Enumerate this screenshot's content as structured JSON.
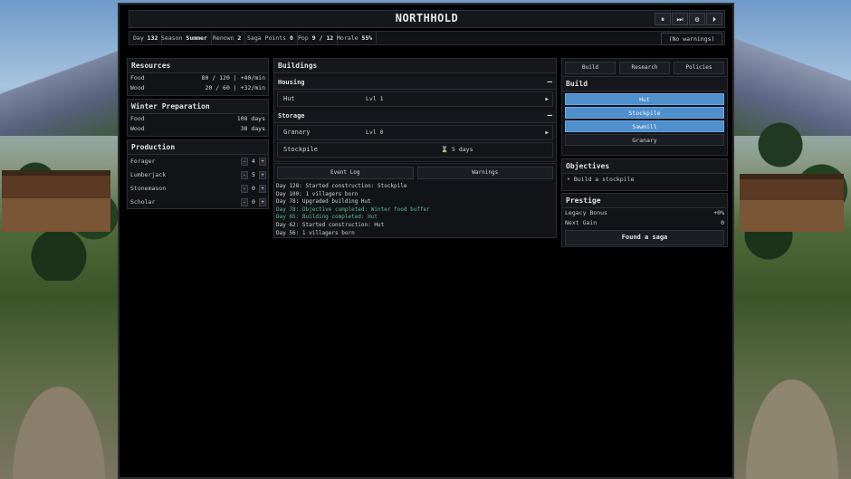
{
  "header": {
    "title": "NORTHHOLD",
    "controls": [
      {
        "icon": "pause-icon",
        "glyph": "⏸"
      },
      {
        "icon": "fast-forward-icon",
        "glyph": "⏭"
      },
      {
        "icon": "gear-icon",
        "glyph": "⚙"
      },
      {
        "icon": "step-forward-icon",
        "glyph": "⏵"
      }
    ]
  },
  "status": {
    "day_label": "Day",
    "day": "132",
    "season_label": "Season",
    "season": "Summer",
    "renown_label": "Renown",
    "renown": "2",
    "saga_label": "Saga Points",
    "saga": "0",
    "pop_label": "Pop",
    "pop": "9 / 12",
    "morale_label": "Morale",
    "morale": "55%",
    "warnings": "(No warnings)"
  },
  "resources": {
    "title": "Resources",
    "items": [
      {
        "label": "Food",
        "value": "80 / 120 | +40/min"
      },
      {
        "label": "Wood",
        "value": "20 / 60 | +32/min"
      }
    ]
  },
  "winter": {
    "title": "Winter Preparation",
    "items": [
      {
        "label": "Food",
        "value": "108 days"
      },
      {
        "label": "Wood",
        "value": "38 days"
      }
    ]
  },
  "production": {
    "title": "Production",
    "items": [
      {
        "label": "Forager",
        "count": "4"
      },
      {
        "label": "Lumberjack",
        "count": "5"
      },
      {
        "label": "Stonemason",
        "count": "0"
      },
      {
        "label": "Scholar",
        "count": "0"
      }
    ],
    "minus": "-",
    "plus": "+"
  },
  "buildings": {
    "title": "Buildings",
    "housing": {
      "title": "Housing",
      "collapse": "—"
    },
    "hut": {
      "name": "Hut",
      "level": "Lvl 1",
      "arrow": "▶"
    },
    "storage": {
      "title": "Storage",
      "collapse": "—"
    },
    "granary": {
      "name": "Granary",
      "level": "Lvl 0",
      "arrow": "▶"
    },
    "stockpile": {
      "name": "Stockpile",
      "timer": "⌛ 5 days"
    }
  },
  "log": {
    "tabs": [
      "Event Log",
      "Warnings"
    ],
    "lines": [
      {
        "text": "Day 128: Started construction: Stockpile",
        "color": "#d2d2d2"
      },
      {
        "text": "Day 100: 1 villagers born",
        "color": "#d2d2d2"
      },
      {
        "text": "Day 78: Upgraded building Hut",
        "color": "#d2d2d2"
      },
      {
        "text": "Day 78: Objective completed: Winter food buffer",
        "color": "#5fb88e"
      },
      {
        "text": "Day 65: Building completed: Hut",
        "color": "#5fb88e"
      },
      {
        "text": "Day 62: Started construction: Hut",
        "color": "#d2d2d2"
      },
      {
        "text": "Day 56: 1 villagers born",
        "color": "#d2d2d2"
      }
    ]
  },
  "right": {
    "tabs": [
      "Build",
      "Research",
      "Policies"
    ],
    "build_title": "Build",
    "build_options": [
      {
        "label": "Hut",
        "available": true
      },
      {
        "label": "Stockpile",
        "available": true
      },
      {
        "label": "Sawmill",
        "available": true
      },
      {
        "label": "Granary",
        "available": false
      }
    ],
    "objectives_title": "Objectives",
    "objective": "• Build a stockpile",
    "prestige_title": "Prestige",
    "legacy_label": "Legacy Bonus",
    "legacy_value": "+0%",
    "next_label": "Next Gain",
    "next_value": "0",
    "found_saga": "Found a saga"
  },
  "colors": {
    "accent": "#4f8fcc",
    "positive": "#5fb88e"
  }
}
